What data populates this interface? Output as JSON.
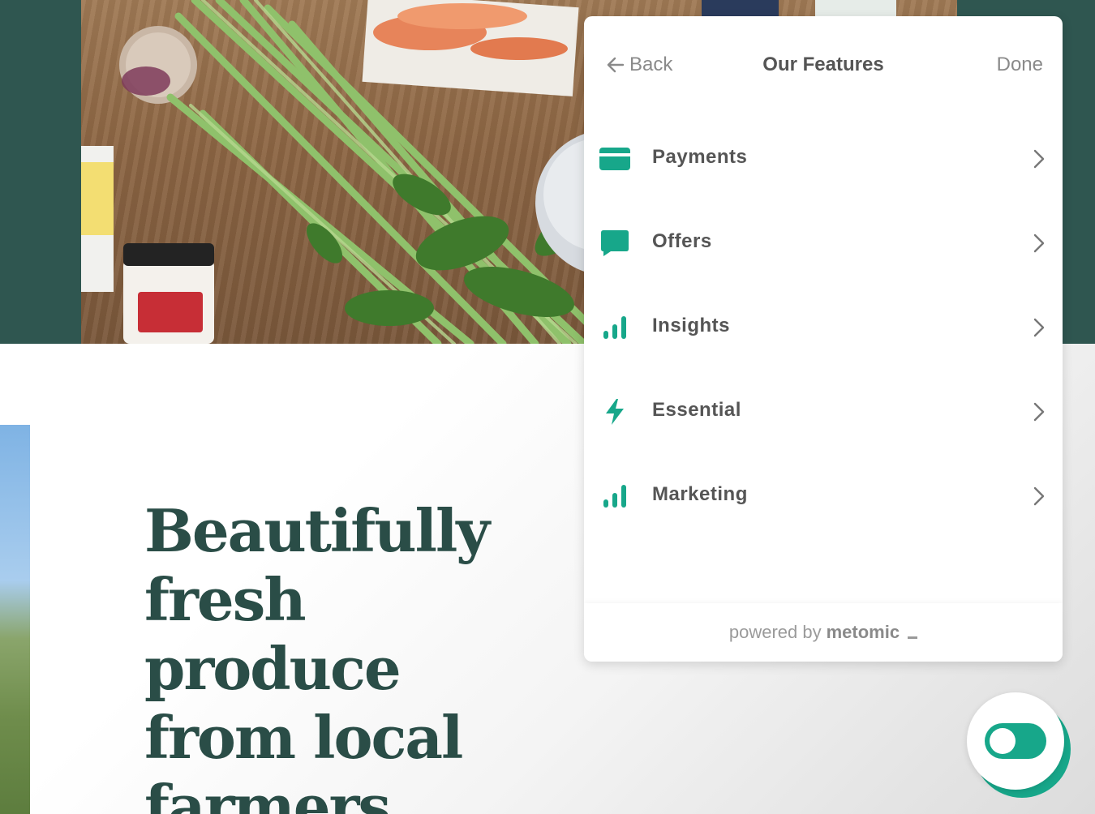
{
  "colors": {
    "accent": "#17a78a",
    "hero_band": "#2f5650",
    "headline": "#2a4d47",
    "panel_text": "#555555",
    "muted_text": "#8a8a8a"
  },
  "page": {
    "headline_lines": [
      "Beautifully",
      "fresh",
      "produce",
      "from local",
      "farmers."
    ]
  },
  "panel": {
    "back_label": "Back",
    "title": "Our Features",
    "done_label": "Done",
    "items": [
      {
        "label": "Payments",
        "icon": "credit-card-icon"
      },
      {
        "label": "Offers",
        "icon": "chat-bubble-icon"
      },
      {
        "label": "Insights",
        "icon": "bar-chart-icon"
      },
      {
        "label": "Essential",
        "icon": "lightning-bolt-icon"
      },
      {
        "label": "Marketing",
        "icon": "bar-chart-icon"
      }
    ],
    "footer": {
      "powered_by": "powered by",
      "brand": "metomic"
    }
  },
  "toggle": {
    "state": "on"
  }
}
